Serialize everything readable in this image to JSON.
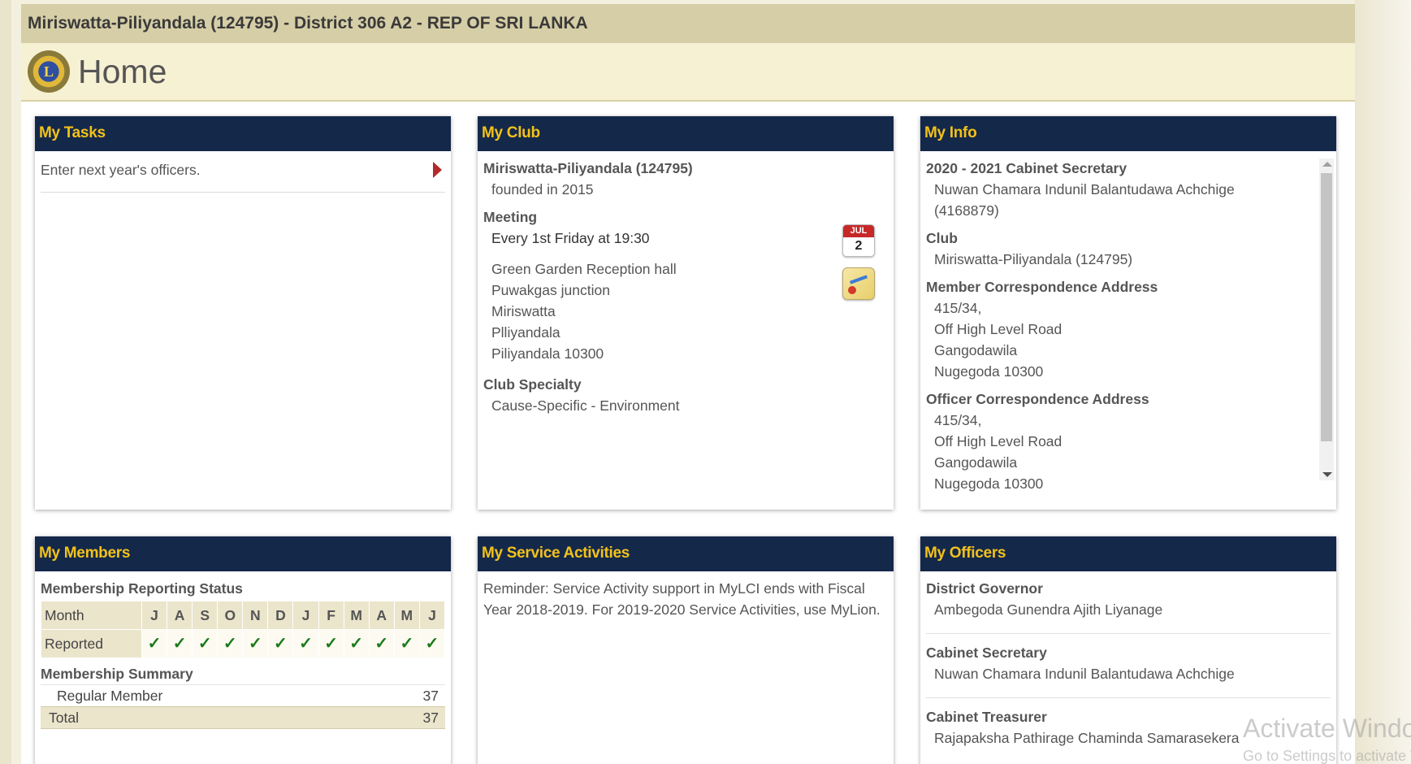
{
  "header": {
    "club_title": "Miriswatta-Piliyandala (124795) - District 306 A2 - REP OF SRI LANKA",
    "page_title": "Home",
    "logo_letter": "L"
  },
  "my_tasks": {
    "title": "My Tasks",
    "tasks": [
      "Enter next year's officers."
    ]
  },
  "my_club": {
    "title": "My Club",
    "club_name": "Miriswatta-Piliyandala (124795)",
    "founded": "founded in 2015",
    "meeting_label": "Meeting",
    "meeting_time": "Every 1st Friday at 19:30",
    "address": [
      "Green Garden Reception hall",
      "Puwakgas junction",
      "Miriswatta",
      "Plliyandala",
      "Piliyandala 10300"
    ],
    "specialty_label": "Club Specialty",
    "specialty": "Cause-Specific - Environment",
    "calendar_icon": {
      "month": "JUL",
      "day": "2"
    }
  },
  "my_info": {
    "title": "My Info",
    "role_label": "2020 - 2021 Cabinet Secretary",
    "name": "Nuwan Chamara Indunil Balantudawa Achchige",
    "member_id": "(4168879)",
    "club_label": "Club",
    "club": "Miriswatta-Piliyandala (124795)",
    "member_address_label": "Member Correspondence Address",
    "member_address": [
      "415/34,",
      "Off High Level Road",
      "Gangodawila",
      "Nugegoda 10300"
    ],
    "officer_address_label": "Officer Correspondence Address",
    "officer_address": [
      "415/34,",
      "Off High Level Road",
      "Gangodawila",
      "Nugegoda 10300"
    ]
  },
  "my_members": {
    "title": "My Members",
    "status_label": "Membership Reporting Status",
    "month_label": "Month",
    "reported_label": "Reported",
    "months": [
      "J",
      "A",
      "S",
      "O",
      "N",
      "D",
      "J",
      "F",
      "M",
      "A",
      "M",
      "J"
    ],
    "reported": [
      "✓",
      "✓",
      "✓",
      "✓",
      "✓",
      "✓",
      "✓",
      "✓",
      "✓",
      "✓",
      "✓",
      "✓"
    ],
    "summary_label": "Membership Summary",
    "summary": [
      {
        "label": "Regular Member",
        "value": "37"
      }
    ],
    "total": {
      "label": "Total",
      "value": "37"
    }
  },
  "my_service": {
    "title": "My Service Activities",
    "text": "Reminder: Service Activity support in MyLCI ends with Fiscal Year 2018-2019. For 2019-2020 Service Activities, use MyLion."
  },
  "my_officers": {
    "title": "My Officers",
    "officers": [
      {
        "role": "District Governor",
        "name": "Ambegoda Gunendra Ajith Liyanage"
      },
      {
        "role": "Cabinet Secretary",
        "name": "Nuwan Chamara Indunil Balantudawa Achchige"
      },
      {
        "role": "Cabinet Treasurer",
        "name": "Rajapaksha Pathirage Chaminda Samarasekera"
      }
    ]
  },
  "watermark": {
    "line1": "Activate Windows",
    "line2": "Go to Settings to activate Windows."
  },
  "colors": {
    "panel_header_bg": "#14284a",
    "panel_header_text": "#f2c21a",
    "topbar_bg": "#d6cea6",
    "check": "#1a7a1a"
  }
}
